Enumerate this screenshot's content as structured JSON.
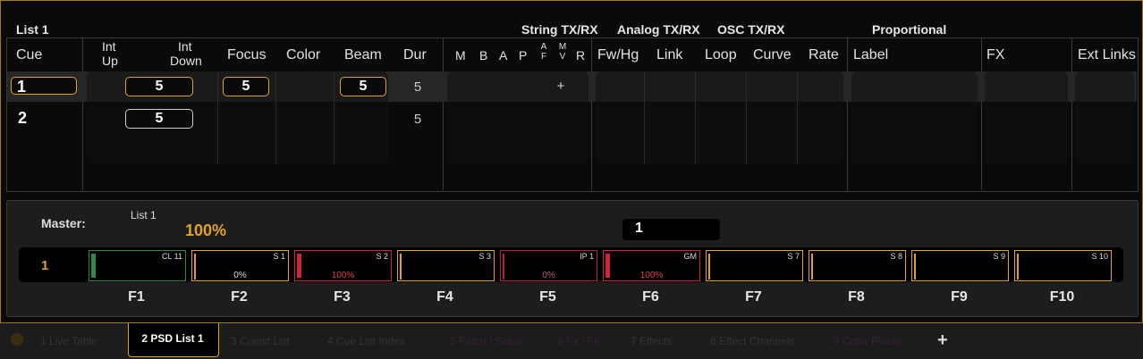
{
  "list_title": "List 1",
  "group_headers": {
    "string": "String TX/RX",
    "analog": "Analog TX/RX",
    "osc": "OSC TX/RX",
    "proportional": "Proportional"
  },
  "columns": {
    "cue": "Cue",
    "int_up_1": "Int",
    "int_up_2": "Up",
    "int_down_1": "Int",
    "int_down_2": "Down",
    "focus": "Focus",
    "color": "Color",
    "beam": "Beam",
    "dur": "Dur",
    "m": "M",
    "b": "B",
    "a": "A",
    "p": "P",
    "af_1": "A",
    "af_2": "F",
    "mv_1": "M",
    "mv_2": "V",
    "r": "R",
    "fwhg": "Fw/Hg",
    "link": "Link",
    "loop": "Loop",
    "curve": "Curve",
    "rate": "Rate",
    "label": "Label",
    "fx": "FX",
    "ext_links": "Ext Links"
  },
  "cues": [
    {
      "number": "1",
      "int_down": "5",
      "focus": "5",
      "beam": "5",
      "dur": "5",
      "flag": "+"
    },
    {
      "number": "2",
      "int_down": "5",
      "focus": "",
      "beam": "",
      "dur": "5",
      "flag": ""
    }
  ],
  "master": {
    "label": "Master:",
    "list_name": "List 1",
    "level": "100%",
    "cue_field": "1",
    "row_label": "1"
  },
  "faders": [
    {
      "key": "F1",
      "tag": "CL 11",
      "pct": "",
      "color": "#2d8a4a",
      "level": 0.9
    },
    {
      "key": "F2",
      "tag": "S 1",
      "pct": "0%",
      "color": "#e0a22a",
      "level": 0
    },
    {
      "key": "F3",
      "tag": "S 2",
      "pct": "100%",
      "color": "#d0243c",
      "level": 1
    },
    {
      "key": "F4",
      "tag": "S 3",
      "pct": "",
      "color": "#e0a22a",
      "level": 0
    },
    {
      "key": "F5",
      "tag": "IP 1",
      "pct": "0%",
      "color": "#b0243c",
      "level": 0
    },
    {
      "key": "F6",
      "tag": "GM",
      "pct": "100%",
      "color": "#d0243c",
      "level": 1
    },
    {
      "key": "F7",
      "tag": "S 7",
      "pct": "",
      "color": "#e0a22a",
      "level": 0
    },
    {
      "key": "F8",
      "tag": "S 8",
      "pct": "",
      "color": "#e0a22a",
      "level": 0
    },
    {
      "key": "F9",
      "tag": "S 9",
      "pct": "",
      "color": "#e0a22a",
      "level": 0
    },
    {
      "key": "F10",
      "tag": "S 10",
      "pct": "",
      "color": "#e0a22a",
      "level": 0
    }
  ],
  "tabs": [
    {
      "label": "1 Live Table"
    },
    {
      "label": "2 PSD List 1"
    },
    {
      "label": "3 Cueist List"
    },
    {
      "label": "4 Cue List Index"
    },
    {
      "label": "5 Patch / Setup"
    },
    {
      "label": "6 Fx / Fc"
    },
    {
      "label": "7 Effects"
    },
    {
      "label": "8 Effect Channels"
    },
    {
      "label": "9 Color Picker"
    }
  ],
  "add_tab": "+",
  "colors": {
    "accent": "#e0a22a",
    "red": "#d0243c",
    "green": "#2d8a4a"
  }
}
